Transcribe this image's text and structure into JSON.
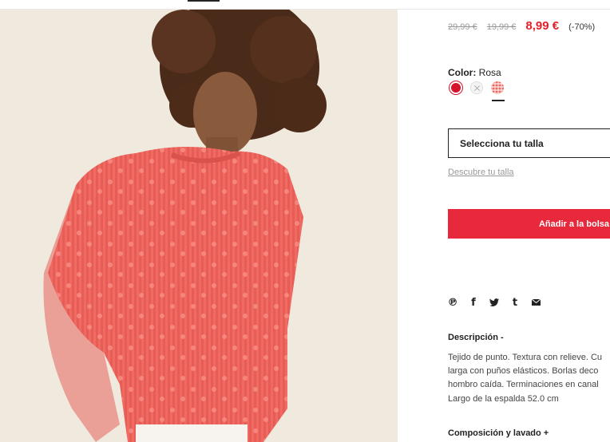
{
  "pricing": {
    "original_price": "29,99 €",
    "previous_price": "19,99 €",
    "current_price": "8,99 €",
    "discount": "(-70%)",
    "accent_color": "#e4202a"
  },
  "color": {
    "label": "Color:",
    "selected_value": "Rosa",
    "swatches": [
      {
        "name": "red",
        "hex": "#d5122c",
        "available": true
      },
      {
        "name": "white",
        "hex": "#f5f5f5",
        "available": false
      },
      {
        "name": "pink-knit",
        "hex": "#ec6a62",
        "available": true,
        "selected": true
      }
    ]
  },
  "size": {
    "select_label": "Selecciona tu talla",
    "guide_link": "Descubre tu talla"
  },
  "actions": {
    "add_to_bag": "Añadir a la bolsa",
    "button_color": "#e8283b"
  },
  "share": {
    "icons": [
      "pinterest-icon",
      "facebook-icon",
      "twitter-icon",
      "tumblr-icon",
      "email-icon"
    ]
  },
  "description": {
    "title": "Descripción -",
    "lines": [
      "Tejido de punto. Textura con relieve. Cu",
      "larga con puños elásticos. Borlas deco",
      "hombro caída. Terminaciones en canal"
    ],
    "back_length": "Largo de la espalda 52.0 cm"
  },
  "composition": {
    "title": "Composición y lavado +"
  }
}
